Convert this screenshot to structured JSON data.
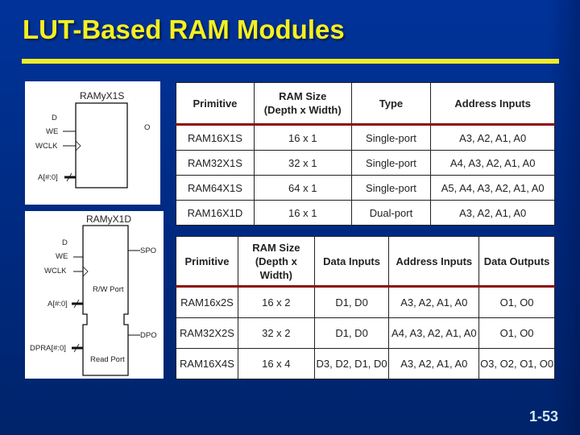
{
  "slide": {
    "title": "LUT-Based RAM Modules",
    "page_number": "1-53",
    "colors": {
      "background": "#003399",
      "title": "#f5f020",
      "rule": "#f0ec28",
      "header_rule": "#8b0d0d",
      "page_number": "#cfe8ff"
    }
  },
  "diagram_single": {
    "title": "RAMyX1S",
    "inputs": [
      "D",
      "WE",
      "WCLK",
      "A[#:0]"
    ],
    "outputs": [
      "O"
    ]
  },
  "diagram_dual": {
    "title": "RAMyX1D",
    "inputs": [
      "D",
      "WE",
      "WCLK",
      "A[#:0]",
      "DPRA[#:0]"
    ],
    "outputs": [
      "SPO",
      "DPO"
    ],
    "sections": [
      "R/W Port",
      "Read Port"
    ]
  },
  "table1": {
    "headers": [
      "Primitive",
      "RAM Size\n(Depth x Width)",
      "Type",
      "Address Inputs"
    ],
    "header_lines": [
      [
        "Primitive"
      ],
      [
        "RAM Size",
        "(Depth x Width)"
      ],
      [
        "Type"
      ],
      [
        "Address Inputs"
      ]
    ],
    "rows": [
      [
        "RAM16X1S",
        "16 x 1",
        "Single-port",
        "A3, A2, A1, A0"
      ],
      [
        "RAM32X1S",
        "32 x 1",
        "Single-port",
        "A4, A3, A2, A1, A0"
      ],
      [
        "RAM64X1S",
        "64 x 1",
        "Single-port",
        "A5, A4, A3, A2, A1, A0"
      ],
      [
        "RAM16X1D",
        "16 x 1",
        "Dual-port",
        "A3, A2, A1, A0"
      ]
    ]
  },
  "table2": {
    "header_lines": [
      [
        "Primitive"
      ],
      [
        "RAM Size",
        "(Depth x Width)"
      ],
      [
        "Data Inputs"
      ],
      [
        "Address Inputs"
      ],
      [
        "Data Outputs"
      ]
    ],
    "rows": [
      [
        "RAM16x2S",
        "16 x 2",
        "D1, D0",
        "A3, A2, A1, A0",
        "O1, O0"
      ],
      [
        "RAM32X2S",
        "32 x 2",
        "D1, D0",
        "A4, A3, A2, A1, A0",
        "O1, O0"
      ],
      [
        "RAM16X4S",
        "16 x 4",
        "D3, D2, D1, D0",
        "A3, A2, A1, A0",
        "O3, O2, O1, O0"
      ]
    ]
  }
}
